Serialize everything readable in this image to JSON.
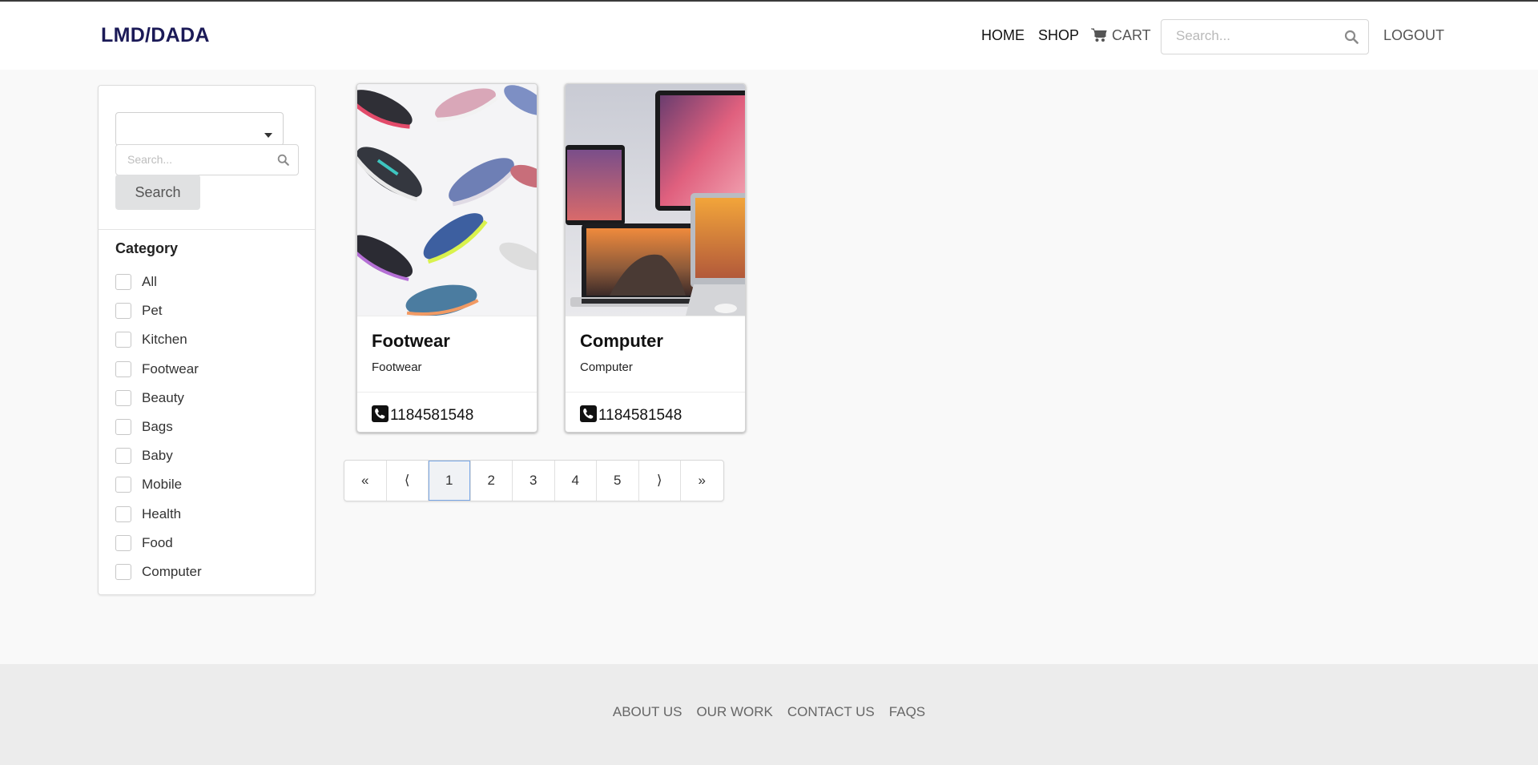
{
  "colors": {
    "brand": "#1b1a57",
    "header_bg": "#ffffff",
    "page_bg": "#f9f9f9",
    "footer_bg": "#ececec",
    "active_page_border": "#7aa7e6"
  },
  "header": {
    "brand": "LMD/DADA",
    "nav": {
      "home": "HOME",
      "shop": "SHOP",
      "cart": "CART",
      "logout": "LOGOUT"
    },
    "cart_icon": "shopping-cart-icon",
    "search": {
      "placeholder": "Search...",
      "value": "",
      "icon": "search-icon"
    }
  },
  "sidebar": {
    "dropdown": {
      "selected": "",
      "icon": "caret-down-icon"
    },
    "search": {
      "placeholder": "Search...",
      "value": "",
      "icon": "search-icon"
    },
    "search_button": "Search",
    "category_title": "Category",
    "categories": [
      {
        "label": "All",
        "checked": false
      },
      {
        "label": "Pet",
        "checked": false
      },
      {
        "label": "Kitchen",
        "checked": false
      },
      {
        "label": "Footwear",
        "checked": false
      },
      {
        "label": "Beauty",
        "checked": false
      },
      {
        "label": "Bags",
        "checked": false
      },
      {
        "label": "Baby",
        "checked": false
      },
      {
        "label": "Mobile",
        "checked": false
      },
      {
        "label": "Health",
        "checked": false
      },
      {
        "label": "Food",
        "checked": false
      },
      {
        "label": "Computer",
        "checked": false
      }
    ]
  },
  "products": [
    {
      "title": "Footwear",
      "subtitle": "Footwear",
      "phone": "1184581548",
      "image": "sneakers-photo",
      "phone_icon": "phone-icon"
    },
    {
      "title": "Computer",
      "subtitle": "Computer",
      "phone": "1184581548",
      "image": "laptops-photo",
      "phone_icon": "phone-icon"
    }
  ],
  "pagination": {
    "first": "«",
    "prev": "⟨",
    "pages": [
      "1",
      "2",
      "3",
      "4",
      "5"
    ],
    "next": "⟩",
    "last": "»",
    "active_page": "1"
  },
  "footer": {
    "links": [
      "ABOUT US",
      "OUR WORK",
      "CONTACT US",
      "FAQS"
    ]
  }
}
